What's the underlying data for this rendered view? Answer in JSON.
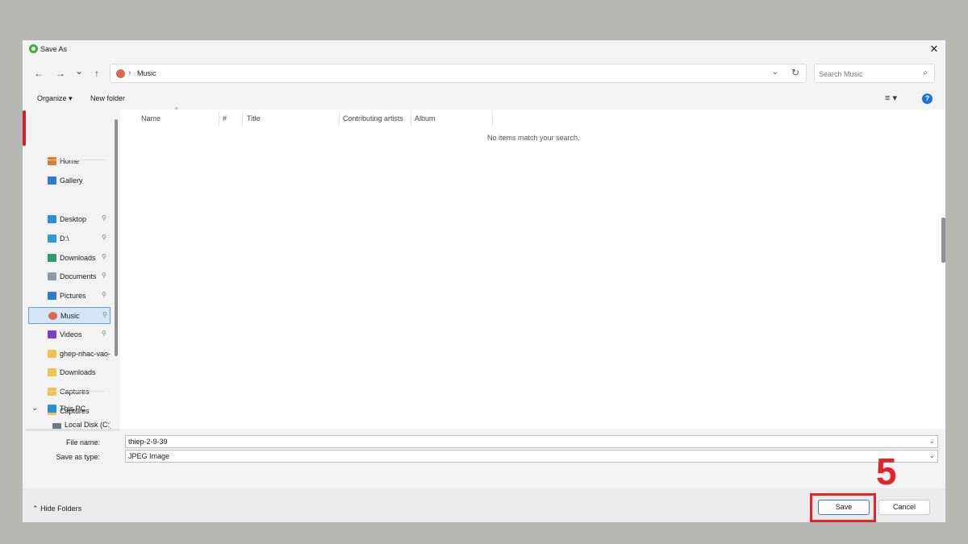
{
  "window": {
    "title": "Save As",
    "close_glyph": "✕"
  },
  "nav_buttons": {
    "back": "←",
    "forward": "→",
    "recent": "⌄",
    "up": "↑"
  },
  "address": {
    "separator": "›",
    "crumb": "Music",
    "dropdown": "⌄",
    "refresh": "↻"
  },
  "search": {
    "placeholder": "Search Music",
    "icon": "⌕"
  },
  "toolbar": {
    "organize": "Organize ▾",
    "new_folder": "New folder",
    "view": "≡ ▾",
    "help": "?"
  },
  "sidebar": {
    "items": [
      {
        "label": "Home",
        "icon": "home-icon",
        "color": "#e07b2a",
        "pinned": false
      },
      {
        "label": "Gallery",
        "icon": "gallery-icon",
        "color": "#2b7bd1",
        "pinned": false
      },
      {
        "label": "Desktop",
        "icon": "desktop-icon",
        "color": "#2a8fd6",
        "pinned": true
      },
      {
        "label": "D:\\",
        "icon": "download-arrow-icon",
        "color": "#2a9bd4",
        "pinned": true
      },
      {
        "label": "Downloads",
        "icon": "downloads-icon",
        "color": "#2a9b6a",
        "pinned": true
      },
      {
        "label": "Documents",
        "icon": "documents-icon",
        "color": "#8a9aad",
        "pinned": true
      },
      {
        "label": "Pictures",
        "icon": "pictures-icon",
        "color": "#2b7bd1",
        "pinned": true
      },
      {
        "label": "Music",
        "icon": "music-icon",
        "color": "#d96a4c",
        "pinned": true
      },
      {
        "label": "Videos",
        "icon": "videos-icon",
        "color": "#7a3fc4",
        "pinned": true
      },
      {
        "label": "ghep-nhac-vao-",
        "icon": "folder-icon",
        "color": "#f2c14e",
        "pinned": false
      },
      {
        "label": "Downloads",
        "icon": "folder-icon",
        "color": "#f2c14e",
        "pinned": false
      },
      {
        "label": "Captures",
        "icon": "folder-icon",
        "color": "#f2c14e",
        "pinned": false
      },
      {
        "label": "Captures",
        "icon": "folder-icon",
        "color": "#f2c14e",
        "pinned": false
      }
    ],
    "this_pc": {
      "label": "This PC",
      "chevron": "⌄"
    },
    "local_disk": {
      "label": "Local Disk (C:)"
    },
    "pin_glyph": "📌"
  },
  "columns": [
    "Name",
    "#",
    "Title",
    "Contributing artists",
    "Album"
  ],
  "empty_message": "No items match your search.",
  "file_name": {
    "label": "File name:",
    "value": "thiep-2-9-39"
  },
  "save_type": {
    "label": "Save as type:",
    "value": "JPEG Image"
  },
  "footer": {
    "hide_folders": "Hide Folders",
    "save": "Save",
    "cancel": "Cancel"
  },
  "annotation": {
    "step": "5",
    "color": "#e3242b"
  }
}
